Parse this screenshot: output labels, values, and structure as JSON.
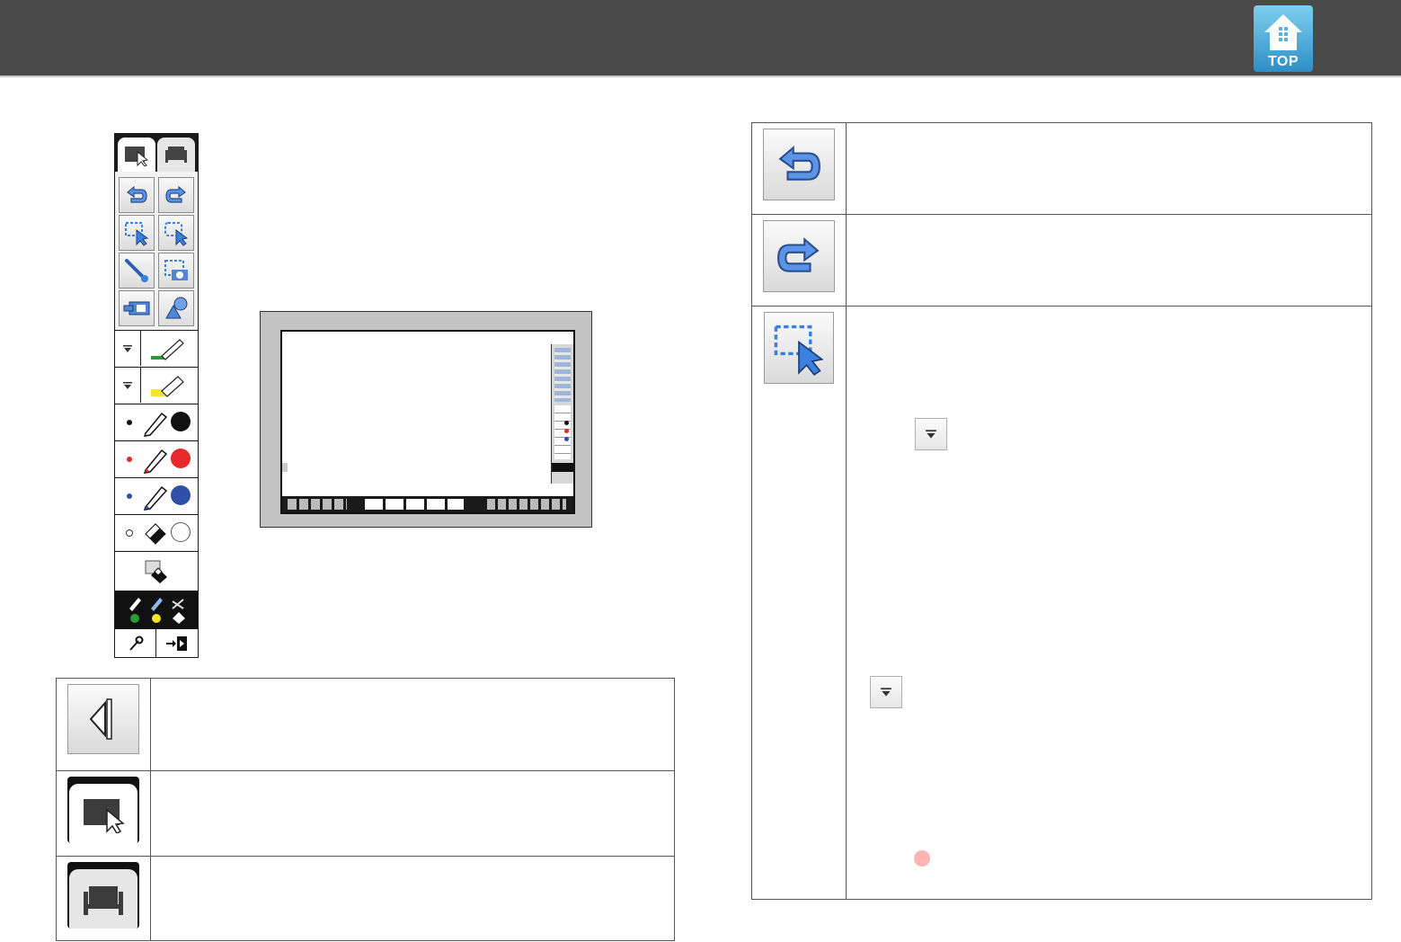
{
  "header": {
    "top_button_label": "TOP",
    "top_button_icon": "home-icon"
  },
  "toolbar": {
    "tabs": [
      {
        "name": "pc-interactive-tab",
        "icon": "computer-cursor-icon"
      },
      {
        "name": "whiteboard-tab",
        "icon": "whiteboard-icon"
      }
    ],
    "buttons": [
      {
        "name": "undo",
        "icon": "undo-icon"
      },
      {
        "name": "redo",
        "icon": "redo-icon"
      },
      {
        "name": "select",
        "icon": "select-arrow-icon"
      },
      {
        "name": "select-all",
        "icon": "select-all-icon"
      },
      {
        "name": "pointer",
        "icon": "pointer-pen-icon"
      },
      {
        "name": "capture",
        "icon": "camera-capture-icon"
      },
      {
        "name": "projector",
        "icon": "projector-icon"
      },
      {
        "name": "shapes",
        "icon": "shapes-icon"
      }
    ],
    "pens": [
      {
        "name": "green-pen",
        "color": "#2a9a3c"
      },
      {
        "name": "yellow-highlighter",
        "color": "#f2e626"
      },
      {
        "name": "black-pen",
        "color": "#111111"
      },
      {
        "name": "red-pen",
        "color": "#e8282a"
      },
      {
        "name": "blue-pen",
        "color": "#2f4fa8"
      },
      {
        "name": "eraser",
        "color": "#ffffff"
      }
    ]
  },
  "colors": {
    "header_bg": "#4a4a4a",
    "accent_blue": "#3b7fe0",
    "red_dot": "#ff8a8a"
  }
}
